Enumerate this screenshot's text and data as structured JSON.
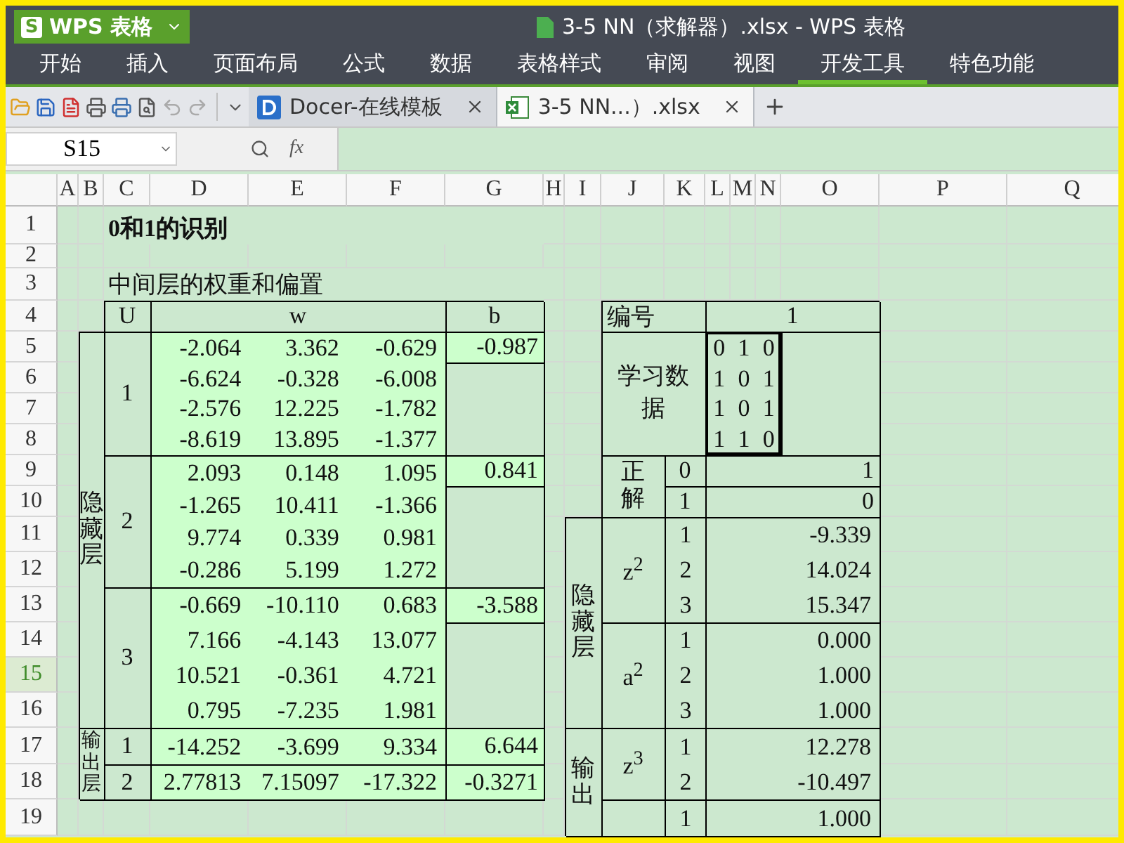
{
  "title_bar": {
    "logo": "S",
    "app_name": "WPS 表格",
    "document_title": "3-5 NN（求解器）.xlsx - WPS 表格"
  },
  "menu": [
    {
      "label": "开始",
      "selected": false
    },
    {
      "label": "插入",
      "selected": false
    },
    {
      "label": "页面布局",
      "selected": false
    },
    {
      "label": "公式",
      "selected": false
    },
    {
      "label": "数据",
      "selected": false
    },
    {
      "label": "表格样式",
      "selected": false
    },
    {
      "label": "审阅",
      "selected": false
    },
    {
      "label": "视图",
      "selected": false
    },
    {
      "label": "开发工具",
      "selected": true
    },
    {
      "label": "特色功能",
      "selected": false
    }
  ],
  "tabs": [
    {
      "label": "Docer-在线模板",
      "kind": "docer",
      "selected": false
    },
    {
      "label": "3-5 NN...）.xlsx",
      "kind": "sheet",
      "selected": true
    }
  ],
  "formula_bar": {
    "name_box": "S15",
    "fx": "fx"
  },
  "sheet": {
    "columns": [
      "A",
      "B",
      "C",
      "D",
      "E",
      "F",
      "G",
      "H",
      "I",
      "J",
      "K",
      "L",
      "M",
      "N",
      "O",
      "P",
      "Q"
    ],
    "rows": [
      {
        "label": "1",
        "selected": false
      },
      {
        "label": "2",
        "selected": false
      },
      {
        "label": "3",
        "selected": false
      },
      {
        "label": "4",
        "selected": false
      },
      {
        "label": "5",
        "selected": false
      },
      {
        "label": "6",
        "selected": false
      },
      {
        "label": "7",
        "selected": false
      },
      {
        "label": "8",
        "selected": false
      },
      {
        "label": "9",
        "selected": false
      },
      {
        "label": "10",
        "selected": false
      },
      {
        "label": "11",
        "selected": false
      },
      {
        "label": "12",
        "selected": false
      },
      {
        "label": "13",
        "selected": false
      },
      {
        "label": "14",
        "selected": false
      },
      {
        "label": "15",
        "selected": true
      },
      {
        "label": "16",
        "selected": false
      },
      {
        "label": "17",
        "selected": false
      },
      {
        "label": "18",
        "selected": false
      },
      {
        "label": "19",
        "selected": false
      }
    ],
    "title": "0和1的识别",
    "subtitle": "中间层的权重和偏置",
    "weights": {
      "headers": [
        "U",
        "w",
        "b"
      ],
      "layers": [
        {
          "label": "隐藏层",
          "kind": "hidden",
          "units": [
            {
              "unit": "1",
              "b": "-0.987",
              "w": [
                [
                  "-2.064",
                  "3.362",
                  "-0.629"
                ],
                [
                  "-6.624",
                  "-0.328",
                  "-6.008"
                ],
                [
                  "-2.576",
                  "12.225",
                  "-1.782"
                ],
                [
                  "-8.619",
                  "13.895",
                  "-1.377"
                ]
              ]
            },
            {
              "unit": "2",
              "b": "0.841",
              "w": [
                [
                  "2.093",
                  "0.148",
                  "1.095"
                ],
                [
                  "-1.265",
                  "10.411",
                  "-1.366"
                ],
                [
                  "9.774",
                  "0.339",
                  "0.981"
                ],
                [
                  "-0.286",
                  "5.199",
                  "1.272"
                ]
              ]
            },
            {
              "unit": "3",
              "b": "-3.588",
              "w": [
                [
                  "-0.669",
                  "-10.110",
                  "0.683"
                ],
                [
                  "7.166",
                  "-4.143",
                  "13.077"
                ],
                [
                  "10.521",
                  "-0.361",
                  "4.721"
                ],
                [
                  "0.795",
                  "-7.235",
                  "1.981"
                ]
              ]
            }
          ]
        },
        {
          "label": "输出层",
          "kind": "output",
          "units": [
            {
              "unit": "1",
              "b": "6.644",
              "w": [
                [
                  "-14.252",
                  "-3.699",
                  "9.334"
                ]
              ]
            },
            {
              "unit": "2",
              "b": "-0.3271",
              "w": [
                [
                  "2.77813",
                  "7.15097",
                  "-17.322"
                ]
              ]
            }
          ]
        }
      ]
    },
    "sample": {
      "id_label": "编号",
      "id_value": "1",
      "learning_label": "学习数据",
      "learning_data": [
        [
          "0",
          "1",
          "0"
        ],
        [
          "1",
          "0",
          "1"
        ],
        [
          "1",
          "0",
          "1"
        ],
        [
          "1",
          "1",
          "0"
        ]
      ],
      "answer_label": "正解",
      "answers": [
        {
          "index": "0",
          "value": "1"
        },
        {
          "index": "1",
          "value": "0"
        }
      ],
      "layers": [
        {
          "label": "隐藏层",
          "groups": [
            {
              "symbol": "z$^{2}$",
              "items": [
                {
                  "index": "1",
                  "value": "-9.339"
                },
                {
                  "index": "2",
                  "value": "14.024"
                },
                {
                  "index": "3",
                  "value": "15.347"
                }
              ]
            },
            {
              "symbol": "a$^{2}$",
              "items": [
                {
                  "index": "1",
                  "value": "0.000"
                },
                {
                  "index": "2",
                  "value": "1.000"
                },
                {
                  "index": "3",
                  "value": "1.000"
                }
              ]
            }
          ]
        },
        {
          "label": "输出",
          "groups": [
            {
              "symbol": "z$^{3}$",
              "items": [
                {
                  "index": "1",
                  "value": "12.278"
                },
                {
                  "index": "2",
                  "value": "-10.497"
                }
              ]
            },
            {
              "items": [
                {
                  "index": "1",
                  "value": "1.000"
                }
              ]
            }
          ]
        }
      ]
    }
  }
}
